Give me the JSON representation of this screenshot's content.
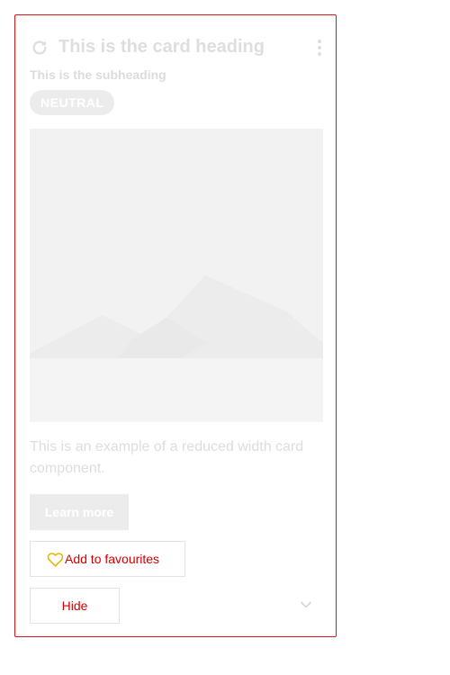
{
  "card": {
    "heading": "This is the card heading",
    "subheading": "This is the subheading",
    "badge": "NEUTRAL",
    "body": "This is an example of a reduced width card component.",
    "actions": {
      "primary_label": "Learn more",
      "favourite_label": "Add to favourites",
      "hide_label": "Hide"
    },
    "icons": {
      "header_left": "refresh-icon",
      "header_right": "more-vertical-icon",
      "favourite": "heart-outline-icon",
      "expand": "chevron-down-icon",
      "media": "image-placeholder-icon"
    }
  },
  "colors": {
    "accent": "#d9141b",
    "action_text": "#d30000",
    "favourite_icon": "#e8b400",
    "disabled_fill": "#ececec",
    "disabled_text": "#dddddd"
  }
}
